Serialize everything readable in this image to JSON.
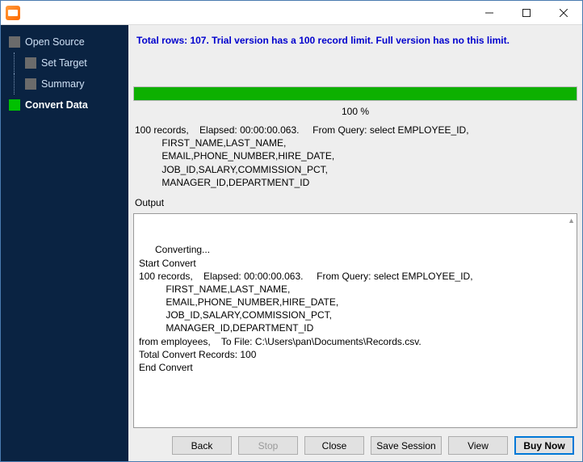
{
  "window": {
    "title": ""
  },
  "sidebar": {
    "items": [
      {
        "label": "Open Source",
        "active": false,
        "child": false
      },
      {
        "label": "Set Target",
        "active": false,
        "child": true
      },
      {
        "label": "Summary",
        "active": false,
        "child": true
      },
      {
        "label": "Convert Data",
        "active": true,
        "child": false
      }
    ]
  },
  "main": {
    "info_banner": "Total rows: 107. Trial version has a 100 record limit. Full version has no this limit.",
    "progress_percent": "100 %",
    "query_block": "100 records,    Elapsed: 00:00:00.063.     From Query: select EMPLOYEE_ID,\n          FIRST_NAME,LAST_NAME,\n          EMAIL,PHONE_NUMBER,HIRE_DATE,\n          JOB_ID,SALARY,COMMISSION_PCT,\n          MANAGER_ID,DEPARTMENT_ID",
    "output_label": "Output",
    "output_text": "Converting...\nStart Convert\n100 records,    Elapsed: 00:00:00.063.     From Query: select EMPLOYEE_ID,\n          FIRST_NAME,LAST_NAME,\n          EMAIL,PHONE_NUMBER,HIRE_DATE,\n          JOB_ID,SALARY,COMMISSION_PCT,\n          MANAGER_ID,DEPARTMENT_ID\nfrom employees,    To File: C:\\Users\\pan\\Documents\\Records.csv.\nTotal Convert Records: 100\nEnd Convert"
  },
  "buttons": {
    "back": "Back",
    "stop": "Stop",
    "close": "Close",
    "save_session": "Save Session",
    "view": "View",
    "buy_now": "Buy Now"
  }
}
